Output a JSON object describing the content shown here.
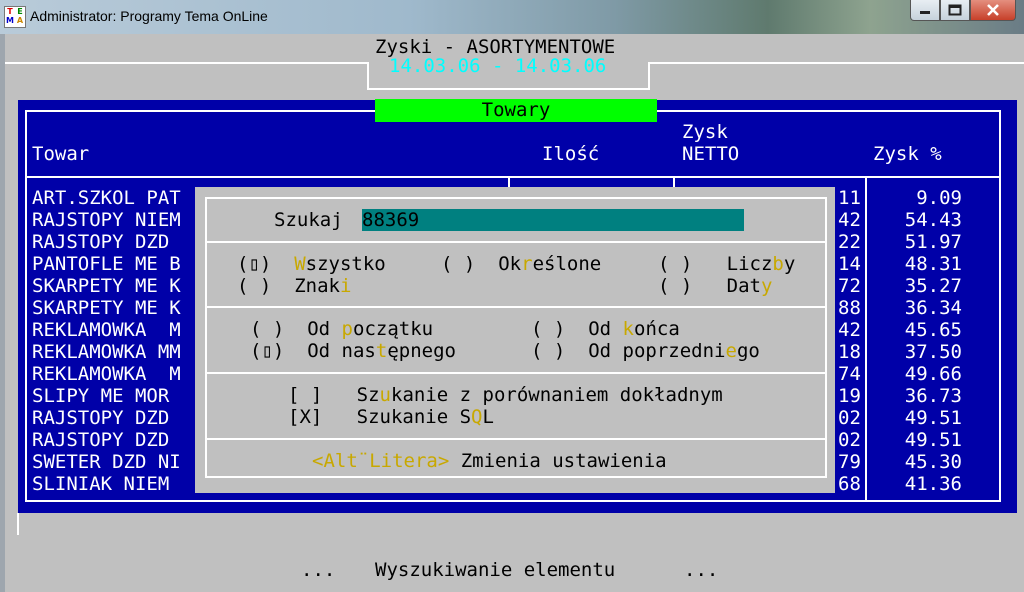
{
  "window": {
    "title": "Administrator:  Programy Tema OnLine",
    "icon_letters": [
      "T",
      "E",
      "M",
      "A"
    ],
    "minimize_icon": "minimize-icon",
    "maximize_icon": "maximize-icon",
    "close_icon": "close-icon"
  },
  "report": {
    "title": "Zyski - ASORTYMENTOWE",
    "date_range": "14.03.06 - 14.03.06",
    "tab_label": "Towary"
  },
  "table": {
    "columns": {
      "towar": "Towar",
      "ilosc": "Ilość",
      "zysk1": "Zysk",
      "zysk2": "NETTO",
      "zysk_pct": "Zysk %"
    },
    "rows": [
      {
        "name": "ART.SZKOL PAT",
        "frag": "11",
        "pct": "9.09"
      },
      {
        "name": "RAJSTOPY NIEM",
        "frag": "42",
        "pct": "54.43"
      },
      {
        "name": "RAJSTOPY DZD",
        "frag": "22",
        "pct": "51.97"
      },
      {
        "name": "PANTOFLE ME B",
        "frag": "14",
        "pct": "48.31"
      },
      {
        "name": "SKARPETY ME K",
        "frag": "72",
        "pct": "35.27"
      },
      {
        "name": "SKARPETY ME K",
        "frag": "88",
        "pct": "36.34"
      },
      {
        "name": "REKLAMOWKA  M",
        "frag": "42",
        "pct": "45.65"
      },
      {
        "name": "REKLAMOWKA MM",
        "frag": "18",
        "pct": "37.50"
      },
      {
        "name": "REKLAMOWKA  M",
        "frag": "74",
        "pct": "49.66"
      },
      {
        "name": "SLIPY ME MOR",
        "frag": "19",
        "pct": "36.73"
      },
      {
        "name": "RAJSTOPY DZD",
        "frag": "02",
        "pct": "49.51"
      },
      {
        "name": "RAJSTOPY DZD",
        "frag": "02",
        "pct": "49.51"
      },
      {
        "name": "SWETER DZD NI",
        "frag": "79",
        "pct": "45.30"
      },
      {
        "name": "SLINIAK NIEM",
        "frag": "68",
        "pct": "41.36"
      }
    ]
  },
  "dialog": {
    "search_label": "Szukaj",
    "search_value": "88369",
    "scope": {
      "wszystko": {
        "mark": "(▯)",
        "a": "",
        "hot": "W",
        "b": "szystko"
      },
      "okreslone": {
        "mark": "( )",
        "a": "Ok",
        "hot": "r",
        "b": "eślone"
      },
      "liczby": {
        "mark": "( )",
        "a": "Licz",
        "hot": "b",
        "b": "y"
      },
      "znaki": {
        "mark": "( )",
        "a": "Znak",
        "hot": "i",
        "b": ""
      },
      "daty": {
        "mark": "( )",
        "a": "Dat",
        "hot": "y",
        "b": ""
      }
    },
    "direction": {
      "od_poczatku": {
        "mark": "( )",
        "a": "Od ",
        "hot": "p",
        "b": "oczątku"
      },
      "od_konca": {
        "mark": "( )",
        "a": "Od ",
        "hot": "k",
        "b": "ońca"
      },
      "od_nastepnego": {
        "mark": "(▯)",
        "a": "Od nas",
        "hot": "t",
        "b": "ępnego"
      },
      "od_poprzedniego": {
        "mark": "( )",
        "a": "Od poprzedni",
        "hot": "e",
        "b": "go"
      }
    },
    "options": {
      "exact": {
        "mark": "[ ]",
        "a": "Sz",
        "hot": "u",
        "b": "kanie z porównaniem dokładnym"
      },
      "sql": {
        "mark": "[X]",
        "a": "Szukanie S",
        "hot": "Q",
        "b": "L"
      }
    },
    "hint": {
      "key": "<Alt¨Litera>",
      "text": " Zmienia ustawienia"
    }
  },
  "status": {
    "left": "...",
    "text": "Wyszukiwanie elementu",
    "right": "..."
  },
  "colors": {
    "navy": "#0000a8",
    "console_gray": "#c0c0c0",
    "highlight_green": "#00ff00",
    "cyan": "#00ffff",
    "hotkey": "#c8a800",
    "search_bg": "#008080"
  }
}
